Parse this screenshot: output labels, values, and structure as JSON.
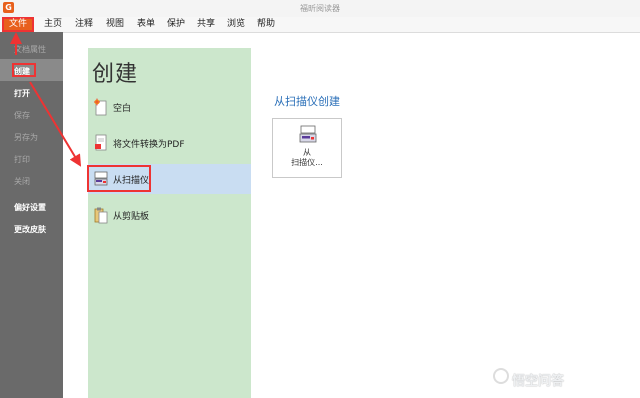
{
  "window": {
    "logo_letter": "G",
    "title": "福昕阅读器"
  },
  "menu": {
    "file": "文件",
    "items": [
      "主页",
      "注释",
      "视图",
      "表单",
      "保护",
      "共享",
      "浏览",
      "帮助"
    ]
  },
  "sidebar": {
    "items": [
      {
        "label": "文档属性"
      },
      {
        "label": "创建"
      },
      {
        "label": "打开"
      },
      {
        "label": "保存"
      },
      {
        "label": "另存为"
      },
      {
        "label": "打印"
      },
      {
        "label": "关闭"
      },
      {
        "label": "偏好设置"
      },
      {
        "label": "更改皮肤"
      }
    ]
  },
  "create": {
    "title": "创建",
    "options": [
      {
        "label": "空白",
        "icon": "blank-document-icon"
      },
      {
        "label": "将文件转换为PDF",
        "icon": "convert-file-icon"
      },
      {
        "label": "从扫描仪",
        "icon": "scanner-icon"
      },
      {
        "label": "从剪贴板",
        "icon": "clipboard-icon"
      }
    ]
  },
  "scanner": {
    "heading": "从扫描仪创建",
    "card_line1": "从",
    "card_line2": "扫描仪..."
  },
  "watermark": {
    "text": "悟空问答"
  },
  "colors": {
    "accent": "#e8601c",
    "highlight_red": "#e33333",
    "panel_green": "#cce7cc",
    "selected_blue": "#c9ddf2",
    "sidebar_gray": "#6a6a6a",
    "link_blue": "#2a6fb8"
  }
}
